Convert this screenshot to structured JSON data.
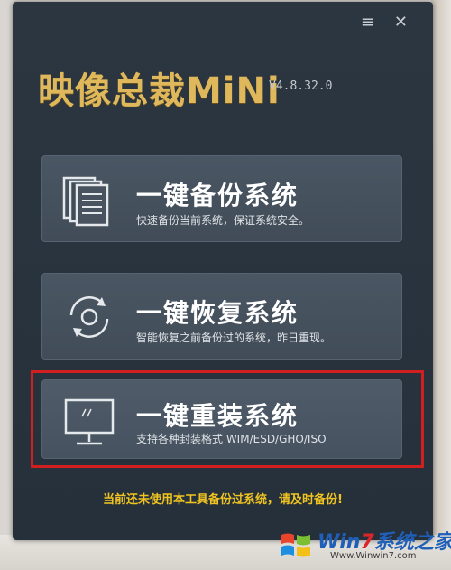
{
  "window": {
    "menu_icon": "≡",
    "close_icon": "✕"
  },
  "app": {
    "title": "映像总裁MiNi",
    "version": "V4.8.32.0"
  },
  "actions": [
    {
      "title": "一键备份系统",
      "desc": "快速备份当前系统，保证系统安全。",
      "icon": "documents-icon"
    },
    {
      "title": "一键恢复系统",
      "desc": "智能恢复之前备份过的系统，昨日重现。",
      "icon": "restore-icon"
    },
    {
      "title": "一键重装系统",
      "desc": "支持各种封装格式 WIM/ESD/GHO/ISO",
      "icon": "monitor-icon"
    }
  ],
  "warning": "当前还未使用本工具备份过系统，请及时备份!",
  "watermark": {
    "text_part1": "Win",
    "text_part2": "7",
    "text_part3": "系统之家",
    "url": "Www.Winwin7.com"
  },
  "colors": {
    "title_gold": "#e0b85c",
    "warning_yellow": "#f0c420",
    "highlight_red": "#d11f1f",
    "window_bg": "#2c3640"
  }
}
